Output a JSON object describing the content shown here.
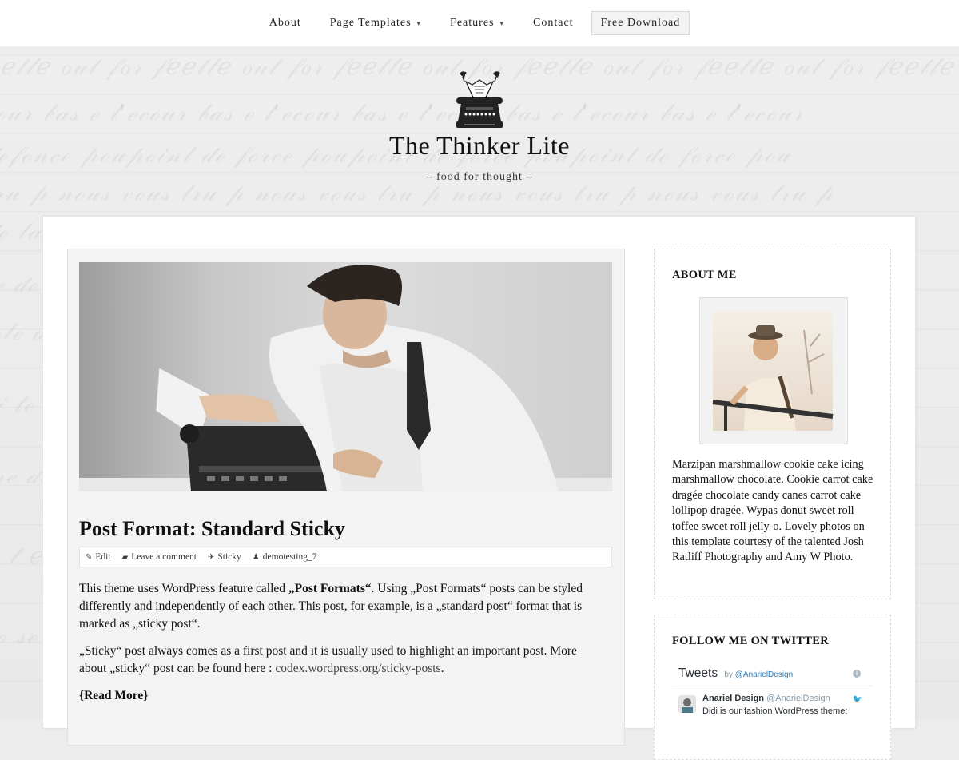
{
  "nav": {
    "items": [
      {
        "label": "About",
        "has_dropdown": false
      },
      {
        "label": "Page Templates",
        "has_dropdown": true
      },
      {
        "label": "Features",
        "has_dropdown": true
      },
      {
        "label": "Contact",
        "has_dropdown": false
      }
    ],
    "download_label": "Free Download",
    "dropdown_icon": "chevron-down-icon"
  },
  "header": {
    "title": "The Thinker Lite",
    "tagline": "– food for thought –",
    "logo_icon": "typewriter-with-birds-logo"
  },
  "post": {
    "title": "Post Format: Standard Sticky",
    "image_alt": "man at typewriter",
    "meta": {
      "edit": "Edit",
      "comment": "Leave a comment",
      "sticky": "Sticky",
      "author": "demotesting_7",
      "icons": [
        "pencil-icon",
        "comment-icon",
        "pin-icon",
        "user-icon"
      ]
    },
    "p1_a": "This theme uses WordPress feature called ",
    "p1_b": "„Post Formats“",
    "p1_c": ". Using „Post Formats“ posts can be styled differently and independently of each other. This post, for example, is a „standard post“ format that is marked as „sticky post“.",
    "p2_a": "„Sticky“ post always comes as a first post and it is usually used to highlight an important post. More about „sticky“ post can be found here : ",
    "p2_link": "codex.wordpress.org/sticky-posts",
    "p2_end": ".",
    "read_more": "{Read More}"
  },
  "sidebar": {
    "about": {
      "title": "ABOUT ME",
      "text": "Marzipan marshmallow cookie cake icing marshmallow chocolate. Cookie carrot cake dragée chocolate candy canes carrot cake lollipop dragée. Wypas donut sweet roll toffee sweet roll jelly-o. Lovely photos on this template courtesy of the talented Josh Ratliff Photography and Amy W Photo."
    },
    "twitter": {
      "title": "FOLLOW ME ON TWITTER",
      "header": "Tweets",
      "by": "by",
      "handle": "@AnarielDesign",
      "tweet_name": "Anariel Design",
      "tweet_handle": "@AnarielDesign",
      "tweet_text": "Didi is our fashion WordPress theme:"
    }
  },
  "colors": {
    "link": "#444444",
    "twitter_blue": "#2b7bb9",
    "background": "#ececec"
  }
}
